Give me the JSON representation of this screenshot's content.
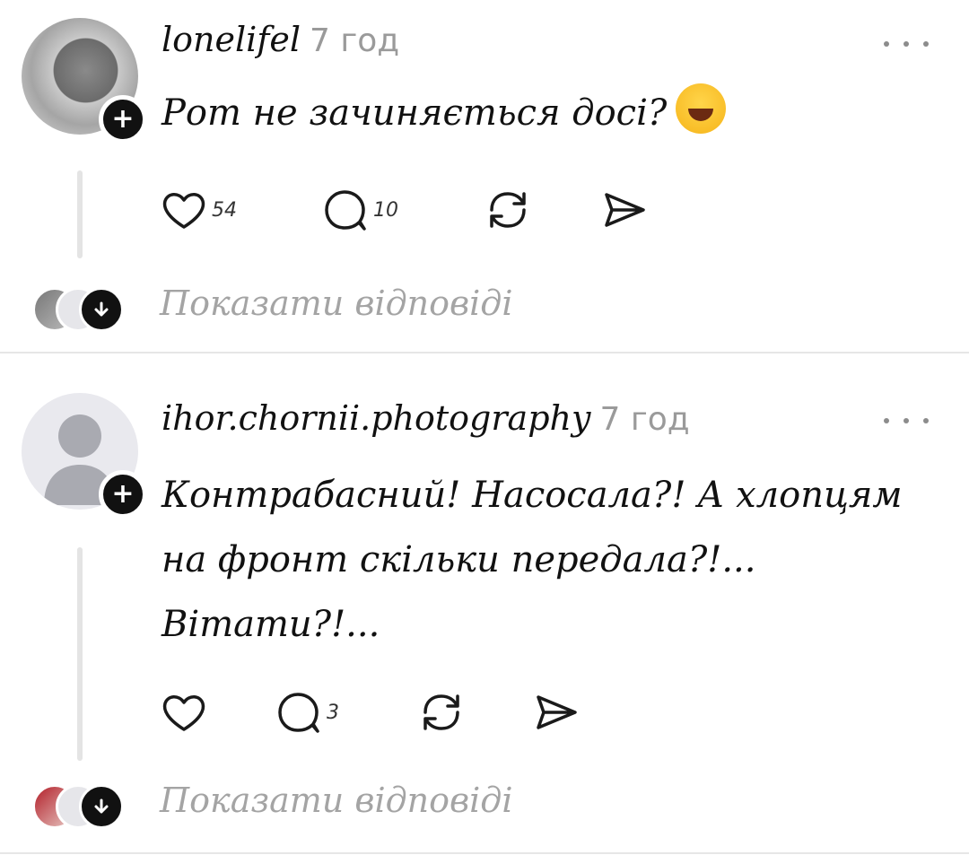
{
  "posts": [
    {
      "username": "lonelifel",
      "time": "7 год",
      "text": "Рот не зачиняється досі?",
      "emoji": "face-with-tears-of-joy",
      "likes": "54",
      "comments": "10",
      "show_replies": "Показати відповіді"
    },
    {
      "username": "ihor.chornii.photography",
      "time": "7 год",
      "text": "Контрабасний! Насосала?! А хлопцям на фронт скільки передала?!... Вітати?!...",
      "likes": "",
      "comments": "3",
      "show_replies": "Показати відповіді"
    }
  ],
  "colors": {
    "text": "#111111",
    "muted": "#9a9a9a",
    "badge": "#111111",
    "divider": "#e6e6e6"
  },
  "icons": [
    "plus-icon",
    "more-dots-icon",
    "heart-icon",
    "comment-icon",
    "repost-icon",
    "share-icon",
    "arrow-down-icon"
  ]
}
